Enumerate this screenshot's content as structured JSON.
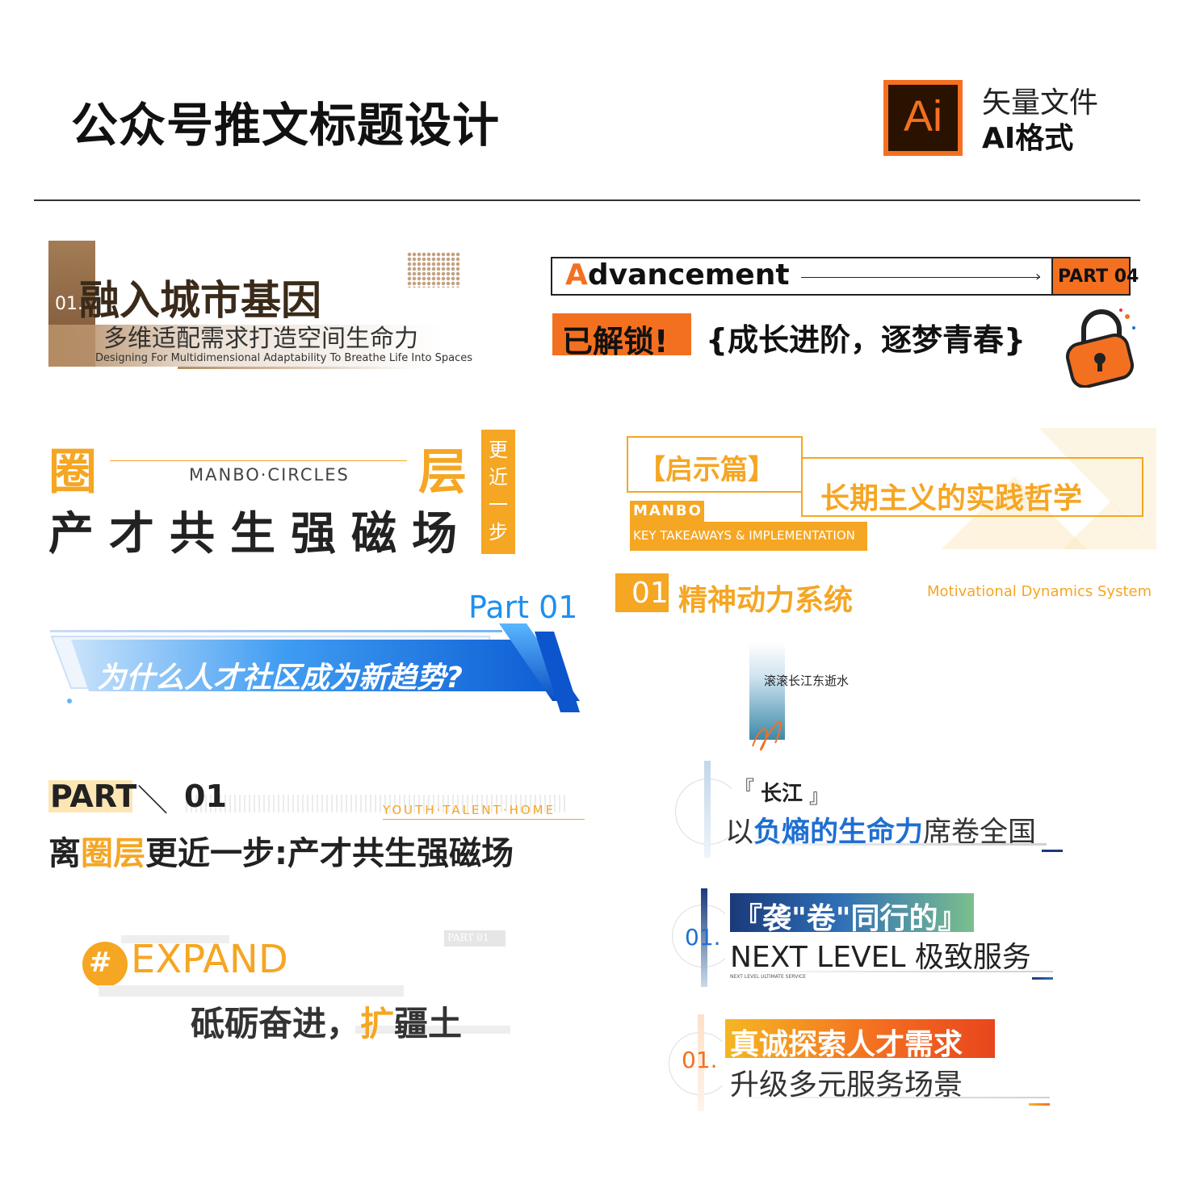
{
  "colors": {
    "orange": "#f37021",
    "gold": "#f5a623",
    "brown": "#7a5a3a",
    "blue": "#1f6fd1",
    "navy": "#1a3a7a"
  },
  "header": {
    "title": "公众号推文标题设计",
    "ai_logo_text": "Ai",
    "vector_label": "矢量文件",
    "format_label": "AI格式"
  },
  "card1": {
    "num": "01.",
    "title": "融入城市基因",
    "subtitle": "多维适配需求打造空间生命力",
    "english": "Designing For Multidimensional Adaptability To Breathe Life Into Spaces"
  },
  "card2": {
    "word_first": "A",
    "word_rest": "dvancement",
    "part": "PART 04",
    "unlocked": "已解锁!",
    "slogan": "{成长进阶，逐梦青春}"
  },
  "card3": {
    "char_left": "圈",
    "english": "MANBO·CIRCLES",
    "char_right": "层",
    "main": "产才共生强磁场",
    "side": "更近一步"
  },
  "card4": {
    "bracket": "【启示篇】",
    "title": "长期主义的实践哲学",
    "brand": "MANBO",
    "english": "KEY TAKEAWAYS & IMPLEMENTATION"
  },
  "card5": {
    "num": "01",
    "title": "精神动力系统",
    "english": "Motivational Dynamics System"
  },
  "card6": {
    "part": "Part 01",
    "title": "为什么人才社区成为新趋势?"
  },
  "card7": {
    "caption": "滚滚长江东逝水"
  },
  "card8": {
    "part_word": "PART",
    "part_num": "01",
    "english": "YOUTH·TALENT·HOME",
    "title_a": "离",
    "title_b": "圈层",
    "title_c": "更近一步:产才共生强磁场"
  },
  "card9": {
    "bracket_open": "『",
    "word": "长江",
    "bracket_close": "』",
    "text_a": "以",
    "text_b": "负熵的生命力",
    "text_c": "席卷全国"
  },
  "card10": {
    "hash": "#",
    "word": "EXPAND",
    "part_tag": "PART 01",
    "text_a": "砥砺奋进，",
    "text_b": "扩",
    "text_c": "疆土"
  },
  "card11": {
    "num": "01.",
    "highlight": "『袭\"卷\"同行的』",
    "line2": "NEXT LEVEL 极致服务",
    "tiny": "NEXT LEVEL ULTIMATE SERVICE"
  },
  "card12": {
    "num": "01.",
    "highlight": "真诚探索人才需求",
    "line2": "升级多元服务场景"
  }
}
